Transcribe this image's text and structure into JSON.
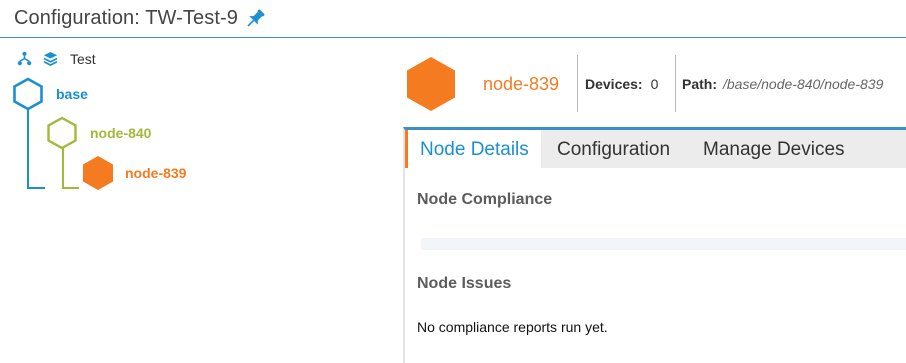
{
  "header": {
    "title": "Configuration: TW-Test-9",
    "pin_icon": "pin-icon"
  },
  "tree": {
    "root": {
      "icons": [
        "hierarchy-icon",
        "layers-icon"
      ],
      "label": "Test"
    },
    "nodes": [
      {
        "label": "base",
        "color": "#1a8fd1",
        "style": "outline"
      },
      {
        "label": "node-840",
        "color": "#a5b83b",
        "style": "outline"
      },
      {
        "label": "node-839",
        "color": "#f47b20",
        "style": "filled",
        "selected": true
      }
    ]
  },
  "node_header": {
    "name": "node-839",
    "devices_label": "Devices:",
    "devices_value": "0",
    "path_label": "Path:",
    "path_value": "/base/node-840/node-839"
  },
  "tabs": [
    {
      "label": "Node Details",
      "active": true
    },
    {
      "label": "Configuration",
      "active": false
    },
    {
      "label": "Manage Devices",
      "active": false
    }
  ],
  "details": {
    "compliance_title": "Node Compliance",
    "issues_title": "Node Issues",
    "issues_message": "No compliance reports run yet."
  },
  "colors": {
    "accent": "#1a8fd1",
    "selected": "#f47b20",
    "level2": "#a5b83b",
    "header_rule": "#3a8fc6"
  }
}
